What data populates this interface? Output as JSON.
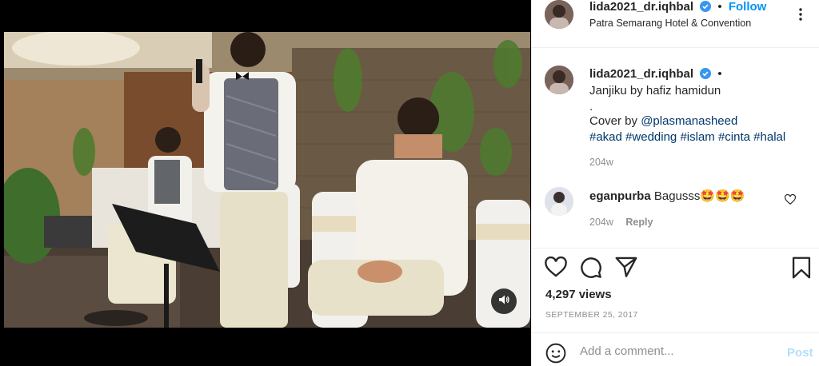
{
  "post": {
    "username": "lida2021_dr.iqhbal",
    "follow_label": "Follow",
    "location": "Patra Semarang Hotel & Convention"
  },
  "caption": {
    "username": "lida2021_dr.iqhbal",
    "line1": "Janjiku by hafiz hamidun",
    "line2": ".",
    "line3_prefix": "Cover by ",
    "mention": "@plasmanasheed",
    "hashtags": [
      "#akad",
      "#wedding",
      "#islam",
      "#cinta",
      "#halal"
    ],
    "age": "204w"
  },
  "comments": [
    {
      "username": "eganpurba",
      "text": "Bagusss🤩🤩🤩",
      "age": "204w",
      "reply_label": "Reply"
    }
  ],
  "stats": {
    "views": "4,297 views",
    "date": "SEPTEMBER 25, 2017"
  },
  "comment_box": {
    "placeholder": "Add a comment...",
    "post_label": "Post"
  },
  "icons": {
    "verified": "verified-badge-icon",
    "more": "more-options-icon",
    "like": "heart-icon",
    "comment": "comment-bubble-icon",
    "share": "paper-plane-icon",
    "save": "bookmark-icon",
    "emoji": "smiley-icon",
    "mute": "speaker-icon"
  },
  "colors": {
    "accent": "#0095f6",
    "link": "#00376b",
    "muted": "#8e8e8e",
    "post_disabled": "#b2dffc"
  }
}
